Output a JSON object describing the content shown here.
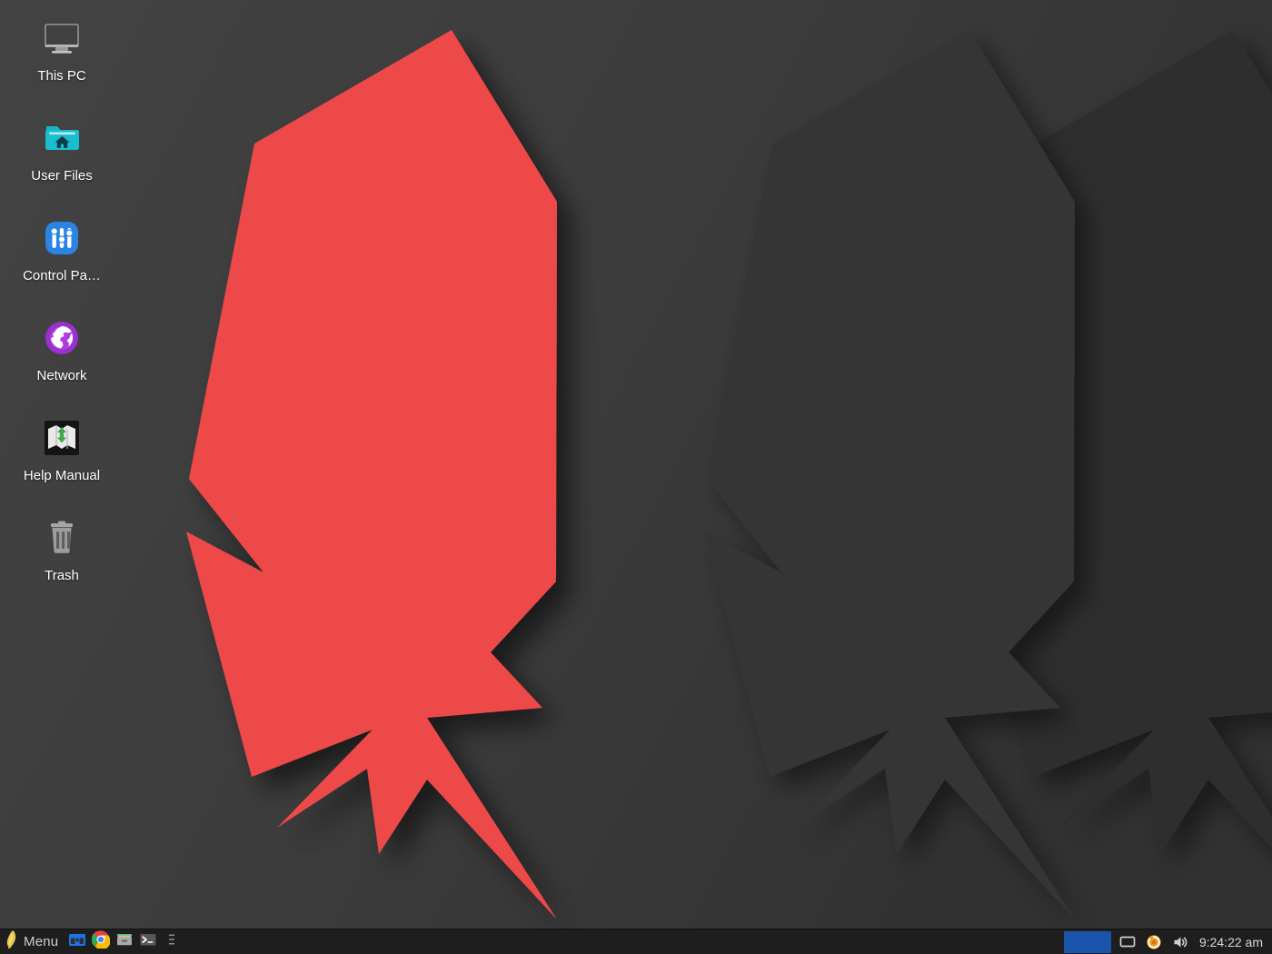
{
  "desktop": {
    "background_color": "#3c3c3c",
    "accent_color": "#ee4a4a",
    "icons": [
      {
        "name": "this-pc",
        "label": "This PC",
        "icon": "monitor-icon"
      },
      {
        "name": "user-files",
        "label": "User Files",
        "icon": "home-folder-icon"
      },
      {
        "name": "control-panel",
        "label": "Control Pa…",
        "icon": "sliders-icon"
      },
      {
        "name": "network",
        "label": "Network",
        "icon": "globe-icon"
      },
      {
        "name": "help-manual",
        "label": "Help Manual",
        "icon": "map-icon"
      },
      {
        "name": "trash",
        "label": "Trash",
        "icon": "trash-icon"
      }
    ]
  },
  "taskbar": {
    "background_color": "#1e1e1e",
    "menu": {
      "label": "Menu",
      "icon": "feather-logo-icon"
    },
    "launchers": [
      {
        "name": "file-manager",
        "icon": "file-manager-icon"
      },
      {
        "name": "chrome",
        "icon": "chrome-icon"
      },
      {
        "name": "archive",
        "icon": "archive-box-icon"
      },
      {
        "name": "terminal",
        "icon": "terminal-icon"
      },
      {
        "name": "more",
        "icon": "kebab-menu-icon"
      }
    ],
    "windows": [
      {
        "name": "active-window-button",
        "color": "#1b55ab"
      }
    ],
    "tray": [
      {
        "name": "display",
        "icon": "display-icon"
      },
      {
        "name": "updates",
        "icon": "update-circle-icon"
      },
      {
        "name": "volume",
        "icon": "speaker-icon"
      }
    ],
    "clock": "9:24:22 am"
  }
}
